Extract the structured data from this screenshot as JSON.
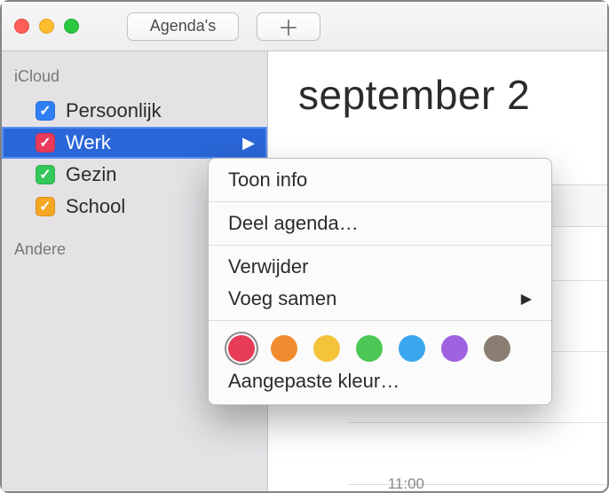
{
  "toolbar": {
    "calendars_label": "Agenda's",
    "add_label": "＋"
  },
  "sidebar": {
    "section_icloud": "iCloud",
    "section_other": "Andere",
    "items": [
      {
        "label": "Persoonlijk",
        "color": "#2f7ff3",
        "selected": false
      },
      {
        "label": "Werk",
        "color": "#ea3b5a",
        "selected": true
      },
      {
        "label": "Gezin",
        "color": "#34c759",
        "selected": false
      },
      {
        "label": "School",
        "color": "#f5a623",
        "selected": false
      }
    ],
    "checkmark": "✓",
    "arrow": "▶"
  },
  "content": {
    "month_title": "september 2",
    "times": {
      "t11": "11:00"
    }
  },
  "menu": {
    "show_info": "Toon info",
    "share": "Deel agenda…",
    "delete": "Verwijder",
    "merge": "Voeg samen",
    "custom_color": "Aangepaste kleur…",
    "sub_arrow": "▶",
    "colors": [
      "#e63c58",
      "#f08b2f",
      "#f4c33a",
      "#4cc755",
      "#3aa6ed",
      "#9f62e0",
      "#8a7e72"
    ],
    "selected_color_index": 0
  }
}
